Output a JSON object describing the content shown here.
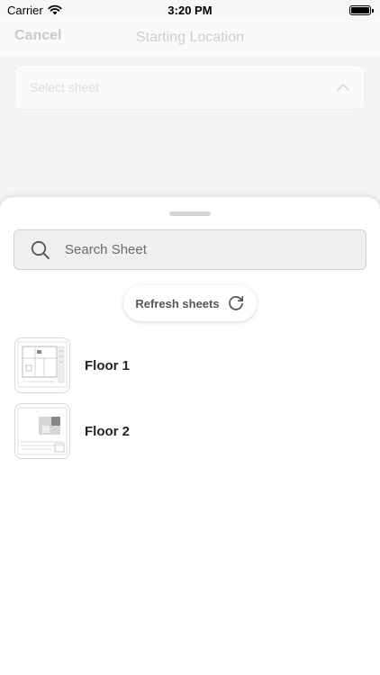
{
  "status_bar": {
    "carrier": "Carrier",
    "time": "3:20 PM"
  },
  "nav": {
    "cancel_label": "Cancel",
    "title": "Starting Location"
  },
  "select": {
    "placeholder": "Select sheet"
  },
  "bottom_sheet": {
    "search_placeholder": "Search Sheet",
    "refresh_label": "Refresh sheets",
    "sheets": [
      {
        "name": "Floor 1"
      },
      {
        "name": "Floor 2"
      }
    ]
  }
}
